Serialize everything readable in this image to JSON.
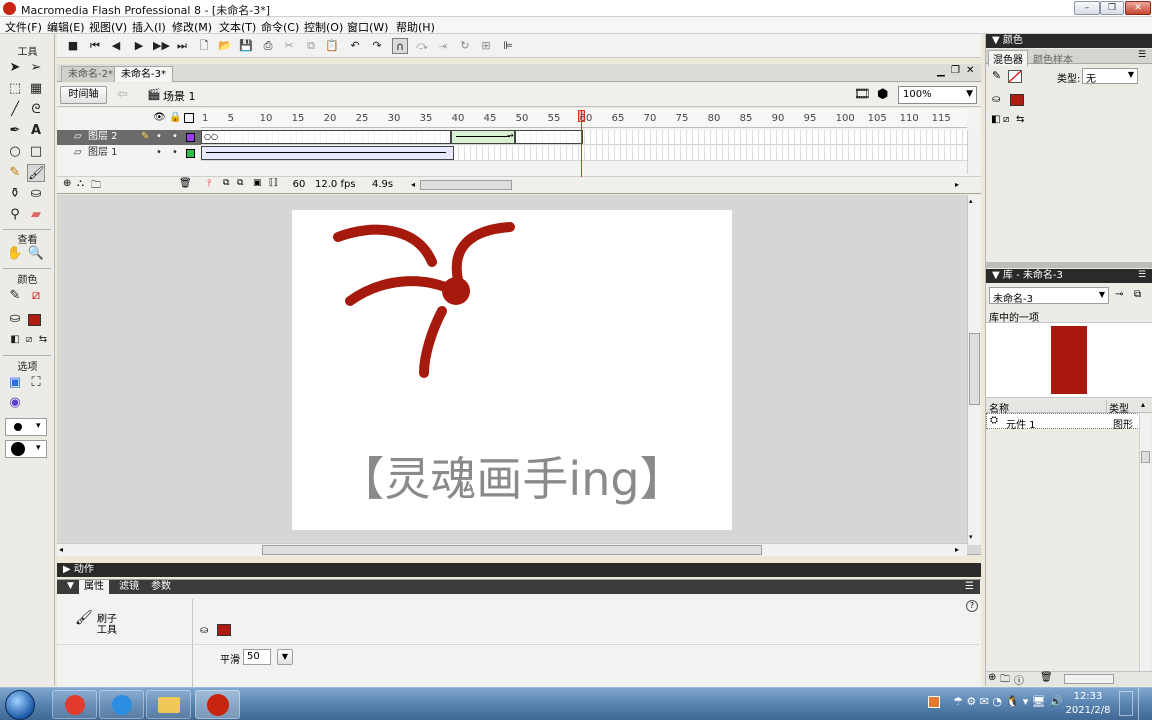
{
  "window": {
    "title": "Macromedia Flash Professional 8 - [未命名-3*]",
    "controls": [
      "minimize",
      "restore",
      "close"
    ]
  },
  "menu": [
    "文件(F)",
    "编辑(E)",
    "视图(V)",
    "插入(I)",
    "修改(M)",
    "文本(T)",
    "命令(C)",
    "控制(O)",
    "窗口(W)",
    "帮助(H)"
  ],
  "toolbox": {
    "title": "工具",
    "view_label": "查看",
    "colors_label": "颜色",
    "options_label": "选项"
  },
  "tabs": [
    {
      "label": "未命名-2*"
    },
    {
      "label": "未命名-3*",
      "active": true
    }
  ],
  "scene": {
    "timeline_btn": "时间轴",
    "scene_name": "场景 1",
    "zoom": "100%"
  },
  "timeline": {
    "ruler": [
      "1",
      "5",
      "10",
      "15",
      "20",
      "25",
      "30",
      "35",
      "40",
      "45",
      "50",
      "55",
      "60",
      "65",
      "70",
      "75",
      "80",
      "85",
      "90",
      "95",
      "100",
      "105",
      "110",
      "115"
    ],
    "layers": [
      {
        "name": "图层 2",
        "selected": true,
        "color": "#9c3cf0"
      },
      {
        "name": "图层 1",
        "selected": false,
        "color": "#2dbf4a"
      }
    ],
    "current_frame": "60",
    "fps": "12.0 fps",
    "elapsed": "4.9s"
  },
  "stage": {
    "watermark": "【灵魂画手ing】",
    "stroke_color": "#a51a0c"
  },
  "panels": {
    "actions": "动作",
    "props_tabs": [
      "属性",
      "滤镜",
      "参数"
    ],
    "tool_name_1": "刷子",
    "tool_name_2": "工具",
    "smooth_label": "平滑",
    "smooth_value": "50"
  },
  "color_panel": {
    "title": "颜色",
    "tabs": [
      "混色器",
      "颜色样本"
    ],
    "type_label": "类型:",
    "type_value": "无",
    "fill_color": "#b01b10"
  },
  "library": {
    "title": "库 - 未命名-3",
    "doc_select": "未命名-3",
    "count": "库中的一项",
    "col_name": "名称",
    "col_type": "类型",
    "items": [
      {
        "name": "元件 1",
        "type": "图形"
      }
    ],
    "preview_color": "#a8180c"
  },
  "tray": {
    "time": "12:33",
    "date": "2021/2/8"
  }
}
